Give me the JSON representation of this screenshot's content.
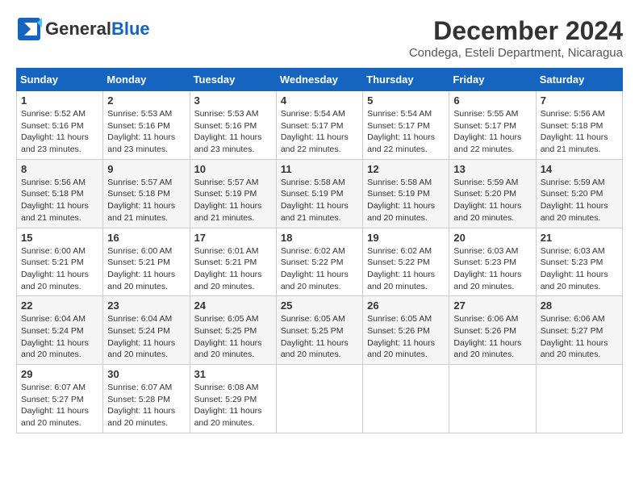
{
  "header": {
    "logo_general": "General",
    "logo_blue": "Blue",
    "month_title": "December 2024",
    "location": "Condega, Esteli Department, Nicaragua"
  },
  "calendar": {
    "days_of_week": [
      "Sunday",
      "Monday",
      "Tuesday",
      "Wednesday",
      "Thursday",
      "Friday",
      "Saturday"
    ],
    "weeks": [
      [
        null,
        null,
        null,
        {
          "day": "4",
          "sunrise": "5:54 AM",
          "sunset": "5:17 PM",
          "daylight": "11 hours and 22 minutes."
        },
        {
          "day": "5",
          "sunrise": "5:54 AM",
          "sunset": "5:17 PM",
          "daylight": "11 hours and 22 minutes."
        },
        {
          "day": "6",
          "sunrise": "5:55 AM",
          "sunset": "5:17 PM",
          "daylight": "11 hours and 22 minutes."
        },
        {
          "day": "7",
          "sunrise": "5:56 AM",
          "sunset": "5:18 PM",
          "daylight": "11 hours and 21 minutes."
        }
      ],
      [
        {
          "day": "1",
          "sunrise": "5:52 AM",
          "sunset": "5:16 PM",
          "daylight": "11 hours and 23 minutes."
        },
        {
          "day": "2",
          "sunrise": "5:53 AM",
          "sunset": "5:16 PM",
          "daylight": "11 hours and 23 minutes."
        },
        {
          "day": "3",
          "sunrise": "5:53 AM",
          "sunset": "5:16 PM",
          "daylight": "11 hours and 23 minutes."
        },
        {
          "day": "4",
          "sunrise": "5:54 AM",
          "sunset": "5:17 PM",
          "daylight": "11 hours and 22 minutes."
        },
        {
          "day": "5",
          "sunrise": "5:54 AM",
          "sunset": "5:17 PM",
          "daylight": "11 hours and 22 minutes."
        },
        {
          "day": "6",
          "sunrise": "5:55 AM",
          "sunset": "5:17 PM",
          "daylight": "11 hours and 22 minutes."
        },
        {
          "day": "7",
          "sunrise": "5:56 AM",
          "sunset": "5:18 PM",
          "daylight": "11 hours and 21 minutes."
        }
      ],
      [
        {
          "day": "8",
          "sunrise": "5:56 AM",
          "sunset": "5:18 PM",
          "daylight": "11 hours and 21 minutes."
        },
        {
          "day": "9",
          "sunrise": "5:57 AM",
          "sunset": "5:18 PM",
          "daylight": "11 hours and 21 minutes."
        },
        {
          "day": "10",
          "sunrise": "5:57 AM",
          "sunset": "5:19 PM",
          "daylight": "11 hours and 21 minutes."
        },
        {
          "day": "11",
          "sunrise": "5:58 AM",
          "sunset": "5:19 PM",
          "daylight": "11 hours and 21 minutes."
        },
        {
          "day": "12",
          "sunrise": "5:58 AM",
          "sunset": "5:19 PM",
          "daylight": "11 hours and 20 minutes."
        },
        {
          "day": "13",
          "sunrise": "5:59 AM",
          "sunset": "5:20 PM",
          "daylight": "11 hours and 20 minutes."
        },
        {
          "day": "14",
          "sunrise": "5:59 AM",
          "sunset": "5:20 PM",
          "daylight": "11 hours and 20 minutes."
        }
      ],
      [
        {
          "day": "15",
          "sunrise": "6:00 AM",
          "sunset": "5:21 PM",
          "daylight": "11 hours and 20 minutes."
        },
        {
          "day": "16",
          "sunrise": "6:00 AM",
          "sunset": "5:21 PM",
          "daylight": "11 hours and 20 minutes."
        },
        {
          "day": "17",
          "sunrise": "6:01 AM",
          "sunset": "5:21 PM",
          "daylight": "11 hours and 20 minutes."
        },
        {
          "day": "18",
          "sunrise": "6:02 AM",
          "sunset": "5:22 PM",
          "daylight": "11 hours and 20 minutes."
        },
        {
          "day": "19",
          "sunrise": "6:02 AM",
          "sunset": "5:22 PM",
          "daylight": "11 hours and 20 minutes."
        },
        {
          "day": "20",
          "sunrise": "6:03 AM",
          "sunset": "5:23 PM",
          "daylight": "11 hours and 20 minutes."
        },
        {
          "day": "21",
          "sunrise": "6:03 AM",
          "sunset": "5:23 PM",
          "daylight": "11 hours and 20 minutes."
        }
      ],
      [
        {
          "day": "22",
          "sunrise": "6:04 AM",
          "sunset": "5:24 PM",
          "daylight": "11 hours and 20 minutes."
        },
        {
          "day": "23",
          "sunrise": "6:04 AM",
          "sunset": "5:24 PM",
          "daylight": "11 hours and 20 minutes."
        },
        {
          "day": "24",
          "sunrise": "6:05 AM",
          "sunset": "5:25 PM",
          "daylight": "11 hours and 20 minutes."
        },
        {
          "day": "25",
          "sunrise": "6:05 AM",
          "sunset": "5:25 PM",
          "daylight": "11 hours and 20 minutes."
        },
        {
          "day": "26",
          "sunrise": "6:05 AM",
          "sunset": "5:26 PM",
          "daylight": "11 hours and 20 minutes."
        },
        {
          "day": "27",
          "sunrise": "6:06 AM",
          "sunset": "5:26 PM",
          "daylight": "11 hours and 20 minutes."
        },
        {
          "day": "28",
          "sunrise": "6:06 AM",
          "sunset": "5:27 PM",
          "daylight": "11 hours and 20 minutes."
        }
      ],
      [
        {
          "day": "29",
          "sunrise": "6:07 AM",
          "sunset": "5:27 PM",
          "daylight": "11 hours and 20 minutes."
        },
        {
          "day": "30",
          "sunrise": "6:07 AM",
          "sunset": "5:28 PM",
          "daylight": "11 hours and 20 minutes."
        },
        {
          "day": "31",
          "sunrise": "6:08 AM",
          "sunset": "5:29 PM",
          "daylight": "11 hours and 20 minutes."
        },
        null,
        null,
        null,
        null
      ]
    ]
  }
}
